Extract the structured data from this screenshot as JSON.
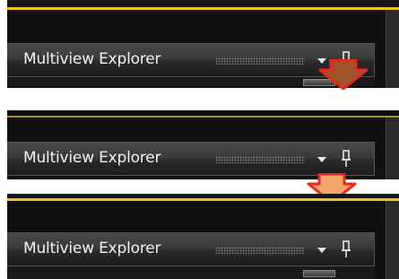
{
  "panels": [
    {
      "title": "Multiview Explorer",
      "dropdown_icon": "chevron-down-icon",
      "pin_icon": "pin-icon",
      "state": "docked"
    },
    {
      "title": "Multiview Explorer",
      "dropdown_icon": "chevron-down-icon",
      "pin_icon": "pin-icon",
      "state": "detached"
    },
    {
      "title": "Multiview Explorer",
      "dropdown_icon": "chevron-down-icon",
      "pin_icon": "pin-icon",
      "state": "docked"
    }
  ],
  "arrows": [
    {
      "icon": "arrow-down-icon",
      "color": "#e8291c",
      "fill": "#a0522d"
    },
    {
      "icon": "arrow-down-icon",
      "color": "#e8291c",
      "fill": "#f4a76c"
    }
  ],
  "colors": {
    "accent": "#f0c419",
    "titlebar_text": "#f2f2f2",
    "panel_bg": "#111111"
  }
}
